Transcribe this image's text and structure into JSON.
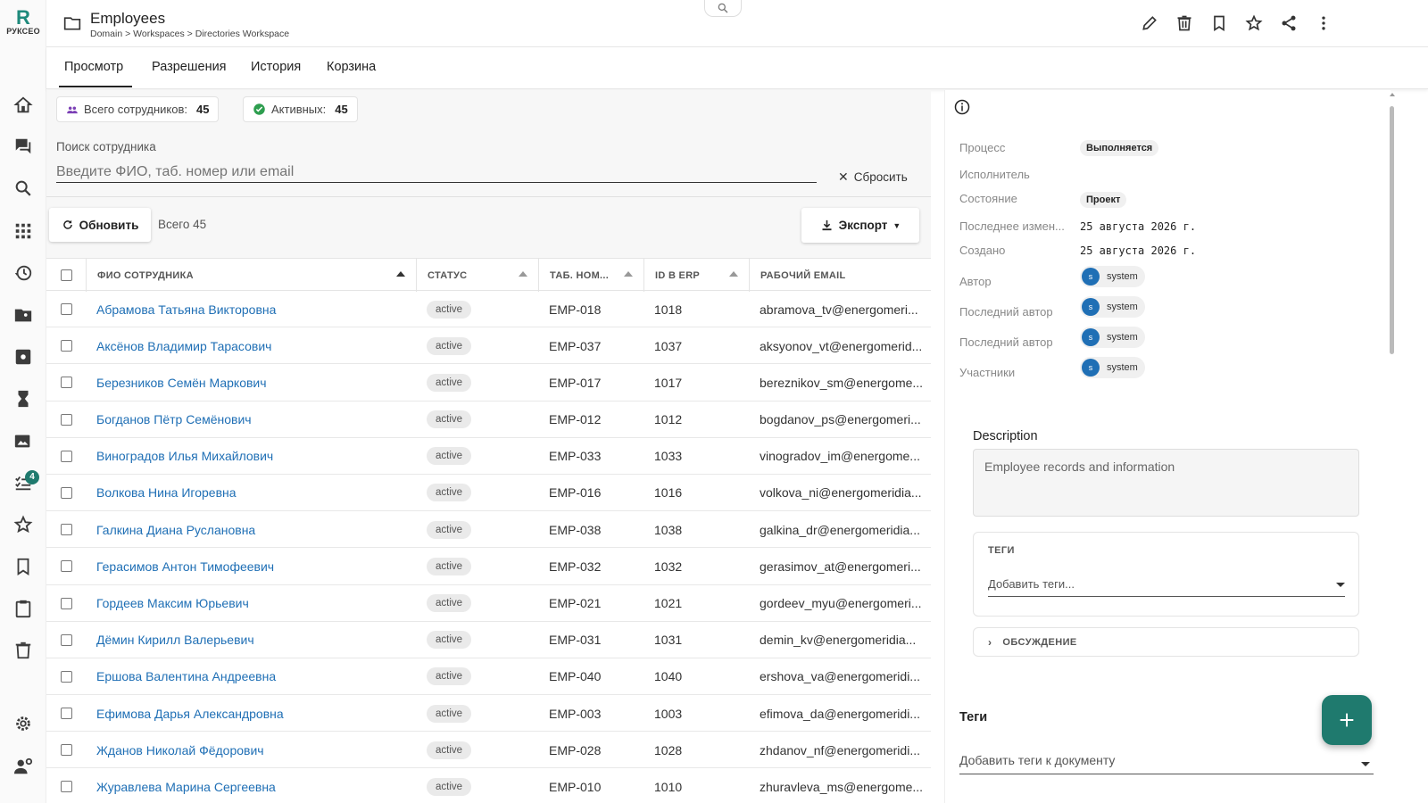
{
  "brand": {
    "letter": "R",
    "name": "РУКСЕО"
  },
  "header": {
    "title": "Employees",
    "breadcrumb": "Domain > Workspaces > Directories Workspace"
  },
  "rail": {
    "badge_count": "4"
  },
  "tabs": [
    {
      "label": "Просмотр"
    },
    {
      "label": "Разрешения"
    },
    {
      "label": "История"
    },
    {
      "label": "Корзина"
    }
  ],
  "stats": {
    "total_label": "Всего сотрудников:",
    "total_value": "45",
    "active_label": "Активных:",
    "active_value": "45"
  },
  "search": {
    "label": "Поиск сотрудника",
    "placeholder": "Введите ФИО, таб. номер или email",
    "reset_label": "Сбросить"
  },
  "toolbar": {
    "refresh_label": "Обновить",
    "total_text": "Всего 45",
    "export_label": "Экспорт"
  },
  "columns": [
    "ФИО СОТРУДНИКА",
    "СТАТУС",
    "ТАБ. НОМ...",
    "ID В ERP",
    "РАБОЧИЙ EMAIL"
  ],
  "rows": [
    {
      "name": "Абрамова Татьяна Викторовна",
      "status": "active",
      "tab": "EMP-018",
      "erp": "1018",
      "email": "abramova_tv@energomeri..."
    },
    {
      "name": "Аксёнов Владимир Тарасович",
      "status": "active",
      "tab": "EMP-037",
      "erp": "1037",
      "email": "aksyonov_vt@energomerid..."
    },
    {
      "name": "Березников Семён Маркович",
      "status": "active",
      "tab": "EMP-017",
      "erp": "1017",
      "email": "bereznikov_sm@energome..."
    },
    {
      "name": "Богданов Пётр Семёнович",
      "status": "active",
      "tab": "EMP-012",
      "erp": "1012",
      "email": "bogdanov_ps@energomeri..."
    },
    {
      "name": "Виноградов Илья Михайлович",
      "status": "active",
      "tab": "EMP-033",
      "erp": "1033",
      "email": "vinogradov_im@energome..."
    },
    {
      "name": "Волкова Нина Игоревна",
      "status": "active",
      "tab": "EMP-016",
      "erp": "1016",
      "email": "volkova_ni@energomeridia..."
    },
    {
      "name": "Галкина Диана Руслановна",
      "status": "active",
      "tab": "EMP-038",
      "erp": "1038",
      "email": "galkina_dr@energomeridia..."
    },
    {
      "name": "Герасимов Антон Тимофеевич",
      "status": "active",
      "tab": "EMP-032",
      "erp": "1032",
      "email": "gerasimov_at@energomeri..."
    },
    {
      "name": "Гордеев Максим Юрьевич",
      "status": "active",
      "tab": "EMP-021",
      "erp": "1021",
      "email": "gordeev_myu@energomeri..."
    },
    {
      "name": "Дёмин Кирилл Валерьевич",
      "status": "active",
      "tab": "EMP-031",
      "erp": "1031",
      "email": "demin_kv@energomeridia..."
    },
    {
      "name": "Ершова Валентина Андреевна",
      "status": "active",
      "tab": "EMP-040",
      "erp": "1040",
      "email": "ershova_va@energomeridi..."
    },
    {
      "name": "Ефимова Дарья Александровна",
      "status": "active",
      "tab": "EMP-003",
      "erp": "1003",
      "email": "efimova_da@energomeridi..."
    },
    {
      "name": "Жданов Николай Фёдорович",
      "status": "active",
      "tab": "EMP-028",
      "erp": "1028",
      "email": "zhdanov_nf@energomeridi..."
    },
    {
      "name": "Журавлева Марина Сергеевна",
      "status": "active",
      "tab": "EMP-010",
      "erp": "1010",
      "email": "zhuravleva_ms@energome..."
    }
  ],
  "side": {
    "process_label": "Процесс",
    "process_value": "Выполняется",
    "executor_label": "Исполнитель",
    "state_label": "Состояние",
    "state_value": "Проект",
    "modified_label": "Последнее измен...",
    "modified_value": "25 августа 2026 г.",
    "created_label": "Создано",
    "created_value": "25 августа 2026 г.",
    "author_label": "Автор",
    "last_author_label": "Последний автор",
    "participants_label": "Участники",
    "user_initial": "s",
    "user_name": "system",
    "description_title": "Description",
    "description_text": "Employee records and information",
    "tags_card_label": "ТЕГИ",
    "tags_card_placeholder": "Добавить теги...",
    "discussion_label": "ОБСУЖДЕНИЕ",
    "tags_title": "Теги",
    "tags_placeholder": "Добавить теги к документу"
  },
  "colors": {
    "accent": "#1f7a6e",
    "link": "#1f6fb5"
  }
}
